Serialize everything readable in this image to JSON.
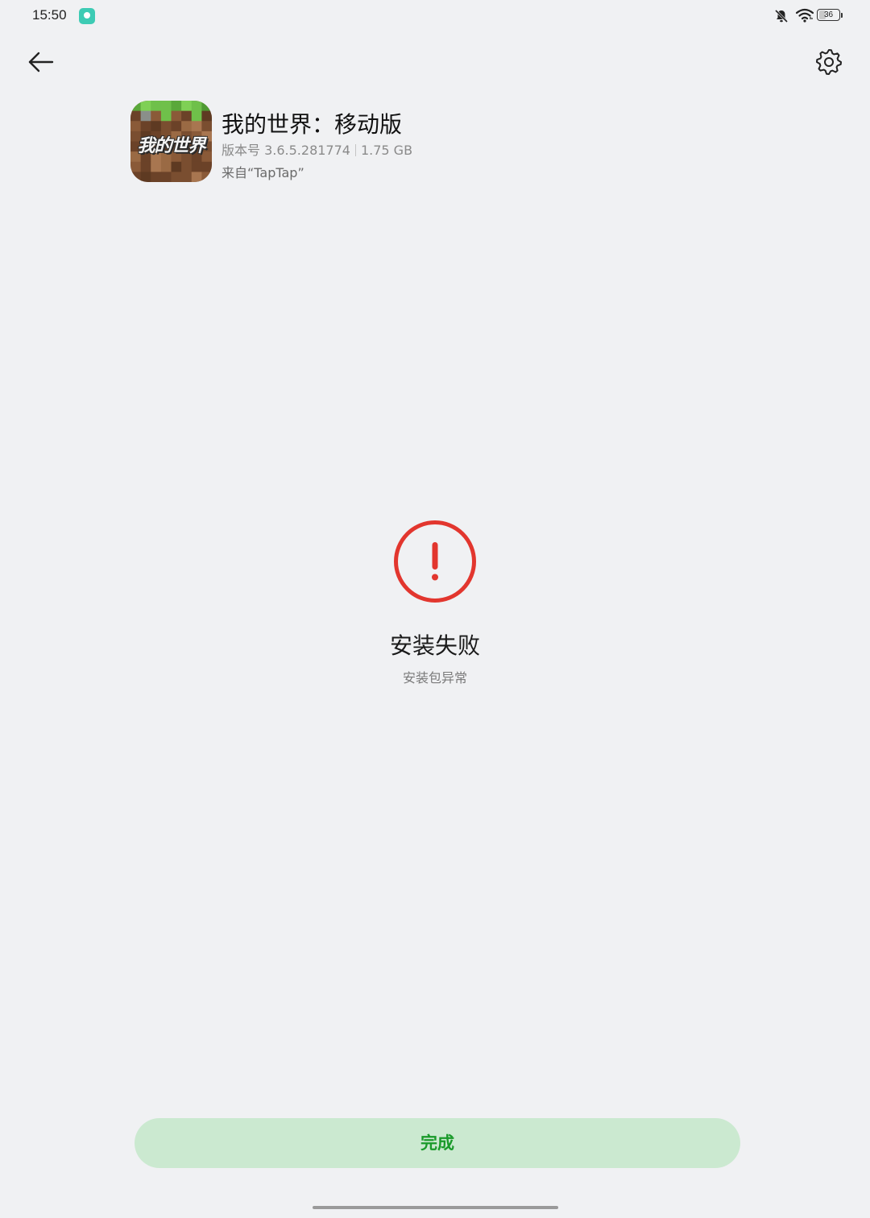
{
  "status_bar": {
    "time": "15:50",
    "battery": "36",
    "battery_percent": 36
  },
  "app": {
    "title": "我的世界：移动版",
    "icon_text": "我的世界",
    "version": "版本号 3.6.5.281774",
    "size": "1.75 GB",
    "source": "来自“TapTap”"
  },
  "status": {
    "title": "安装失败",
    "subtitle": "安装包异常"
  },
  "actions": {
    "done_label": "完成"
  },
  "colors": {
    "error": "#e2362e",
    "accent": "#1a9a2a",
    "button_bg": "#cbe9d0"
  },
  "icons": {
    "back": "arrow-left",
    "settings": "gear",
    "notification": "chat-bubble",
    "mute": "bell-off",
    "wifi": "wifi",
    "error": "exclamation-circle"
  }
}
